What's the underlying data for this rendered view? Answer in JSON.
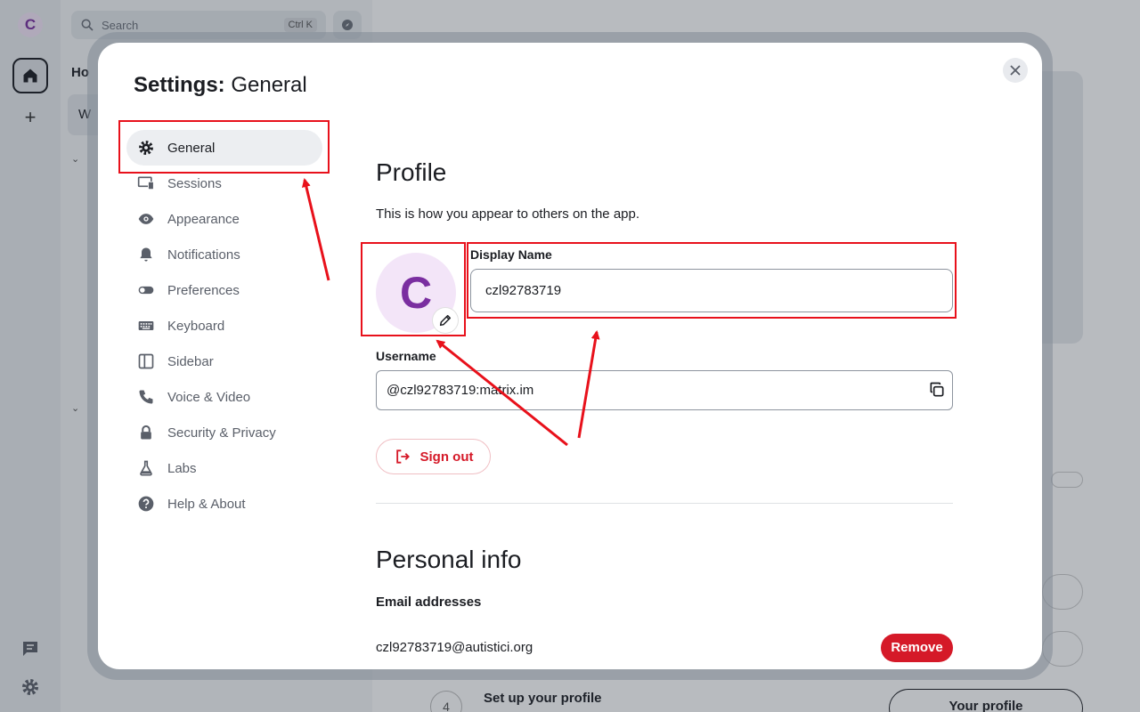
{
  "app": {
    "space_initial": "C",
    "search_placeholder": "Search",
    "search_shortcut": "Ctrl K",
    "home_label": "Ho",
    "room_initial": "W",
    "add_space": "+",
    "step_number": "4",
    "step_text": "Set up your profile",
    "your_profile_button": "Your profile"
  },
  "modal": {
    "title_bold": "Settings:",
    "title_rest": " General",
    "tabs": [
      {
        "label": "General",
        "icon": "gear-icon",
        "active": true
      },
      {
        "label": "Sessions",
        "icon": "devices-icon"
      },
      {
        "label": "Appearance",
        "icon": "eye-icon"
      },
      {
        "label": "Notifications",
        "icon": "bell-icon"
      },
      {
        "label": "Preferences",
        "icon": "toggle-icon"
      },
      {
        "label": "Keyboard",
        "icon": "keyboard-icon"
      },
      {
        "label": "Sidebar",
        "icon": "sidebar-icon"
      },
      {
        "label": "Voice & Video",
        "icon": "phone-icon"
      },
      {
        "label": "Security & Privacy",
        "icon": "lock-icon"
      },
      {
        "label": "Labs",
        "icon": "flask-icon"
      },
      {
        "label": "Help & About",
        "icon": "help-icon"
      }
    ]
  },
  "profile": {
    "heading": "Profile",
    "subtitle": "This is how you appear to others on the app.",
    "avatar_initial": "C",
    "display_name_label": "Display Name",
    "display_name_value": "czl92783719",
    "username_label": "Username",
    "username_value": "@czl92783719:matrix.im",
    "sign_out": "Sign out"
  },
  "personal_info": {
    "heading": "Personal info",
    "email_label": "Email addresses",
    "email_value": "czl92783719@autistici.org",
    "remove": "Remove"
  },
  "colors": {
    "accent_red": "#d51928",
    "annotation_red": "#e8111b",
    "avatar_bg": "#f3e5f8",
    "avatar_fg": "#7a2ea0"
  }
}
